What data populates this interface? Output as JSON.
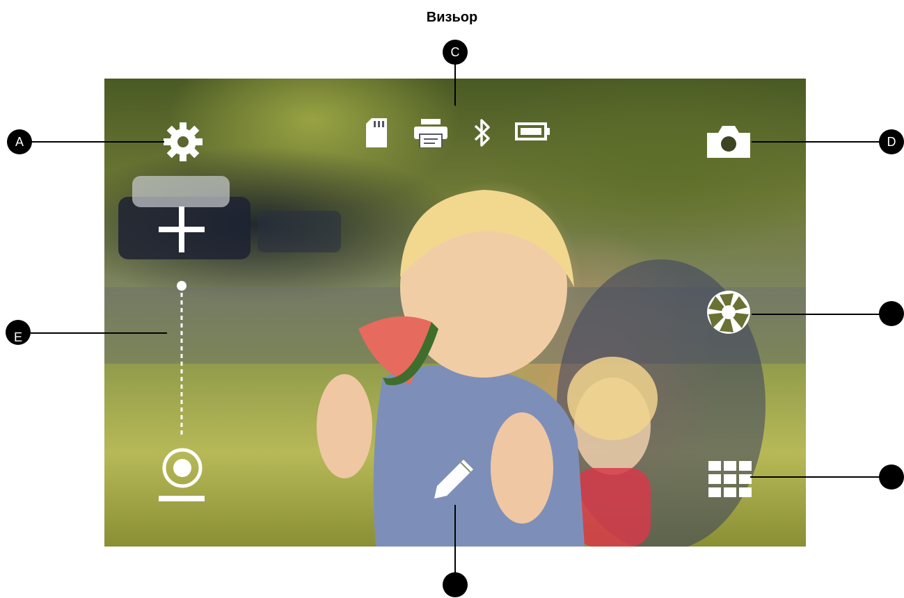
{
  "header": {
    "title": "Визьор"
  },
  "callouts": {
    "a": "A",
    "c": "C",
    "d": "D",
    "e": "E"
  },
  "icons": {
    "settings": "gear-icon",
    "sd_card": "sd-card-icon",
    "printer": "printer-icon",
    "bluetooth": "bluetooth-icon",
    "battery": "battery-icon",
    "camera": "camera-icon",
    "zoom_in": "plus-icon",
    "zoom_slider": "zoom-slider",
    "zoom_out": "minus-icon",
    "shutter": "aperture-icon",
    "edit": "pencil-icon",
    "grid": "grid-icon"
  },
  "colors": {
    "overlay_icon": "#ffffff",
    "callout": "#000000"
  }
}
